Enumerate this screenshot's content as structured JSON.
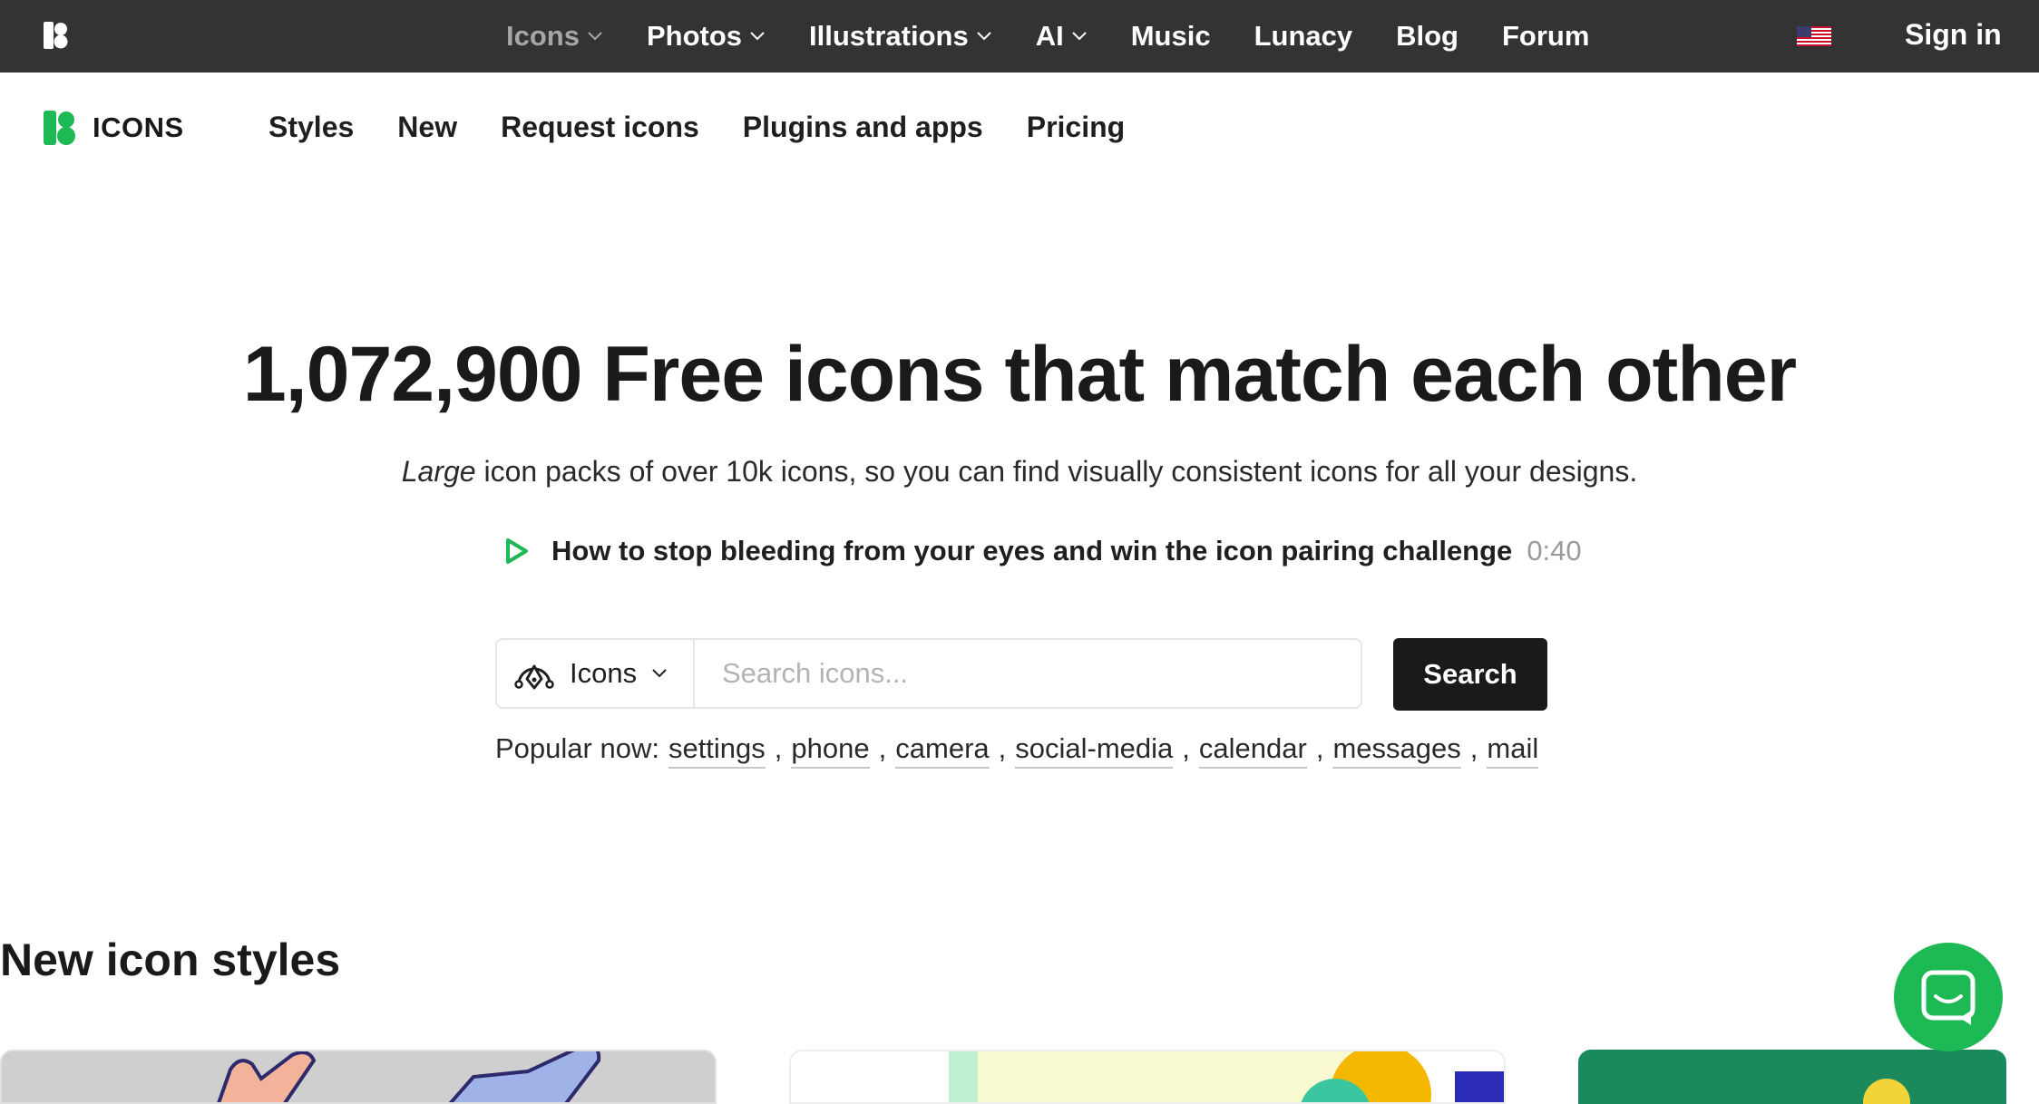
{
  "topbar": {
    "nav": [
      {
        "label": "Icons",
        "has_dropdown": true,
        "active": true
      },
      {
        "label": "Photos",
        "has_dropdown": true
      },
      {
        "label": "Illustrations",
        "has_dropdown": true
      },
      {
        "label": "AI",
        "has_dropdown": true
      },
      {
        "label": "Music"
      },
      {
        "label": "Lunacy"
      },
      {
        "label": "Blog"
      },
      {
        "label": "Forum"
      }
    ],
    "sign_in": "Sign in",
    "flag_icon": "us-flag-icon"
  },
  "subbar": {
    "brand": "ICONS",
    "nav": [
      "Styles",
      "New",
      "Request icons",
      "Plugins and apps",
      "Pricing"
    ]
  },
  "hero": {
    "title": "1,072,900 Free icons that match each other",
    "subtitle_em": "Large",
    "subtitle_rest": " icon packs of over 10k icons, so you can find visually consistent icons for all your designs.",
    "video_title": "How to stop bleeding from your eyes and win the icon pairing challenge",
    "video_duration": "0:40"
  },
  "search": {
    "type_label": "Icons",
    "placeholder": "Search icons...",
    "button": "Search"
  },
  "popular": {
    "label": "Popular now:",
    "tags": [
      "settings",
      "phone",
      "camera",
      "social-media",
      "calendar",
      "messages",
      "mail"
    ]
  },
  "section": {
    "title": "New icon styles"
  },
  "colors": {
    "brand_green": "#1db954",
    "topbar_bg": "#333333",
    "button_dark": "#1a1a1a"
  }
}
